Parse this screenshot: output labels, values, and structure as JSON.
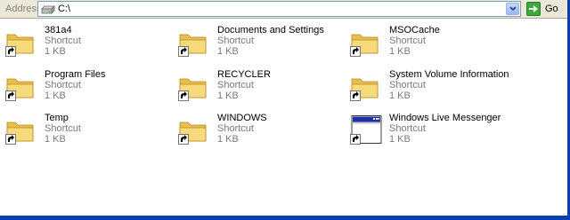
{
  "address_bar": {
    "label": "Address",
    "value": "C:\\",
    "go_label": "Go"
  },
  "items": [
    {
      "name": "381a4",
      "type": "Shortcut",
      "size": "1 KB",
      "icon": "folder-shortcut-icon"
    },
    {
      "name": "Documents and Settings",
      "type": "Shortcut",
      "size": "1 KB",
      "icon": "folder-shortcut-icon"
    },
    {
      "name": "MSOCache",
      "type": "Shortcut",
      "size": "1 KB",
      "icon": "folder-shortcut-icon"
    },
    {
      "name": "Program Files",
      "type": "Shortcut",
      "size": "1 KB",
      "icon": "folder-shortcut-icon"
    },
    {
      "name": "RECYCLER",
      "type": "Shortcut",
      "size": "1 KB",
      "icon": "folder-shortcut-icon"
    },
    {
      "name": "System Volume Information",
      "type": "Shortcut",
      "size": "1 KB",
      "icon": "folder-shortcut-icon"
    },
    {
      "name": "Temp",
      "type": "Shortcut",
      "size": "1 KB",
      "icon": "folder-shortcut-icon"
    },
    {
      "name": "WINDOWS",
      "type": "Shortcut",
      "size": "1 KB",
      "icon": "folder-shortcut-icon"
    },
    {
      "name": "Windows Live Messenger",
      "type": "Shortcut",
      "size": "1 KB",
      "icon": "application-shortcut-icon"
    }
  ],
  "colors": {
    "window_border": "#0A3FB3",
    "toolbar_bg": "#ECE9D8",
    "folder_yellow": "#F5D46A",
    "go_green": "#3DA93A"
  }
}
